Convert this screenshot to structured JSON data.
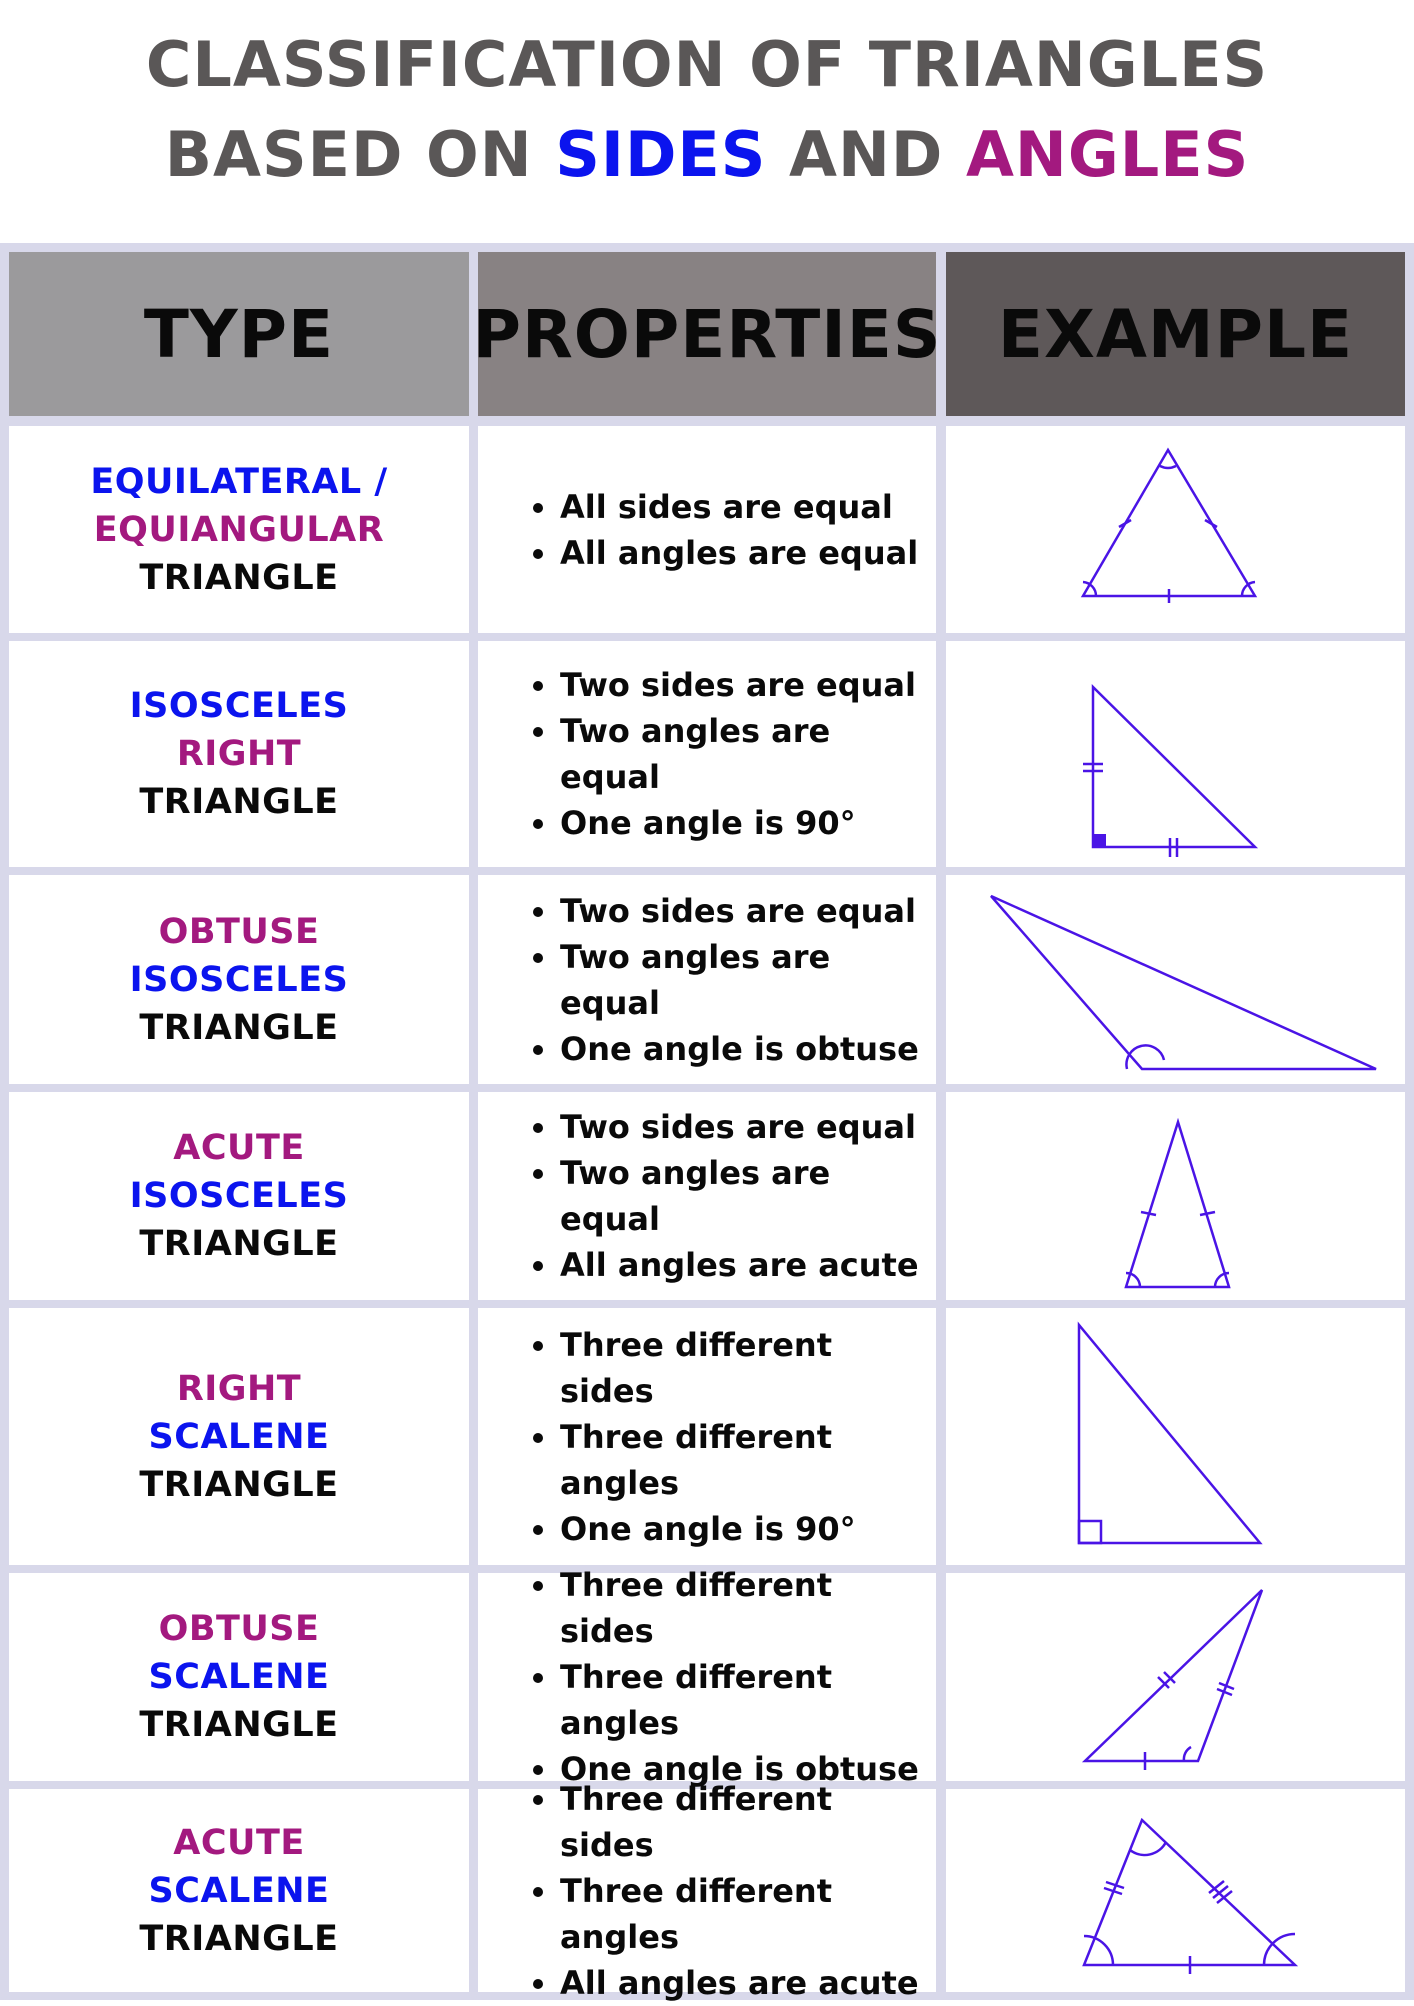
{
  "title": {
    "line1": "CLASSIFICATION OF TRIANGLES",
    "line2_prefix": "BASED ON ",
    "line2_sides": "SIDES",
    "line2_and": " AND ",
    "line2_angles": "ANGLES"
  },
  "headers": {
    "type": "TYPE",
    "properties": "PROPERTIES",
    "example": "EXAMPLE"
  },
  "colors": {
    "sides": "#0b14ee",
    "angles": "#a3197f",
    "shape_stroke": "#4a14e6",
    "title": "#5a5757",
    "grid": "#d8d8ea"
  },
  "rows": [
    {
      "type_lines": [
        {
          "text": "EQUILATERAL /",
          "color": "blue"
        },
        {
          "text": "EQUIANGULAR",
          "color": "magenta"
        },
        {
          "text": "TRIANGLE",
          "color": "black"
        }
      ],
      "properties": [
        "All sides are equal",
        "All angles are equal"
      ]
    },
    {
      "type_lines": [
        {
          "text": "ISOSCELES",
          "color": "blue"
        },
        {
          "text": "RIGHT",
          "color": "magenta"
        },
        {
          "text": "TRIANGLE",
          "color": "black"
        }
      ],
      "properties": [
        "Two sides are equal",
        "Two angles are equal",
        "One angle is 90°"
      ]
    },
    {
      "type_lines": [
        {
          "text": "OBTUSE",
          "color": "magenta"
        },
        {
          "text": "ISOSCELES",
          "color": "blue"
        },
        {
          "text": "TRIANGLE",
          "color": "black"
        }
      ],
      "properties": [
        "Two sides are equal",
        "Two angles are equal",
        "One angle is obtuse"
      ]
    },
    {
      "type_lines": [
        {
          "text": "ACUTE",
          "color": "magenta"
        },
        {
          "text": "ISOSCELES",
          "color": "blue"
        },
        {
          "text": "TRIANGLE",
          "color": "black"
        }
      ],
      "properties": [
        "Two sides are equal",
        "Two angles are equal",
        "All angles are acute"
      ]
    },
    {
      "type_lines": [
        {
          "text": "RIGHT",
          "color": "magenta"
        },
        {
          "text": "SCALENE",
          "color": "blue"
        },
        {
          "text": "TRIANGLE",
          "color": "black"
        }
      ],
      "properties": [
        "Three different sides",
        "Three different angles",
        "One angle is 90°"
      ]
    },
    {
      "type_lines": [
        {
          "text": "OBTUSE",
          "color": "magenta"
        },
        {
          "text": "SCALENE",
          "color": "blue"
        },
        {
          "text": "TRIANGLE",
          "color": "black"
        }
      ],
      "properties": [
        "Three different sides",
        "Three different angles",
        "One angle is obtuse"
      ]
    },
    {
      "type_lines": [
        {
          "text": "ACUTE",
          "color": "magenta"
        },
        {
          "text": "SCALENE",
          "color": "blue"
        },
        {
          "text": "TRIANGLE",
          "color": "black"
        }
      ],
      "properties": [
        "Three different sides",
        "Three different angles",
        "All angles are acute"
      ]
    }
  ]
}
